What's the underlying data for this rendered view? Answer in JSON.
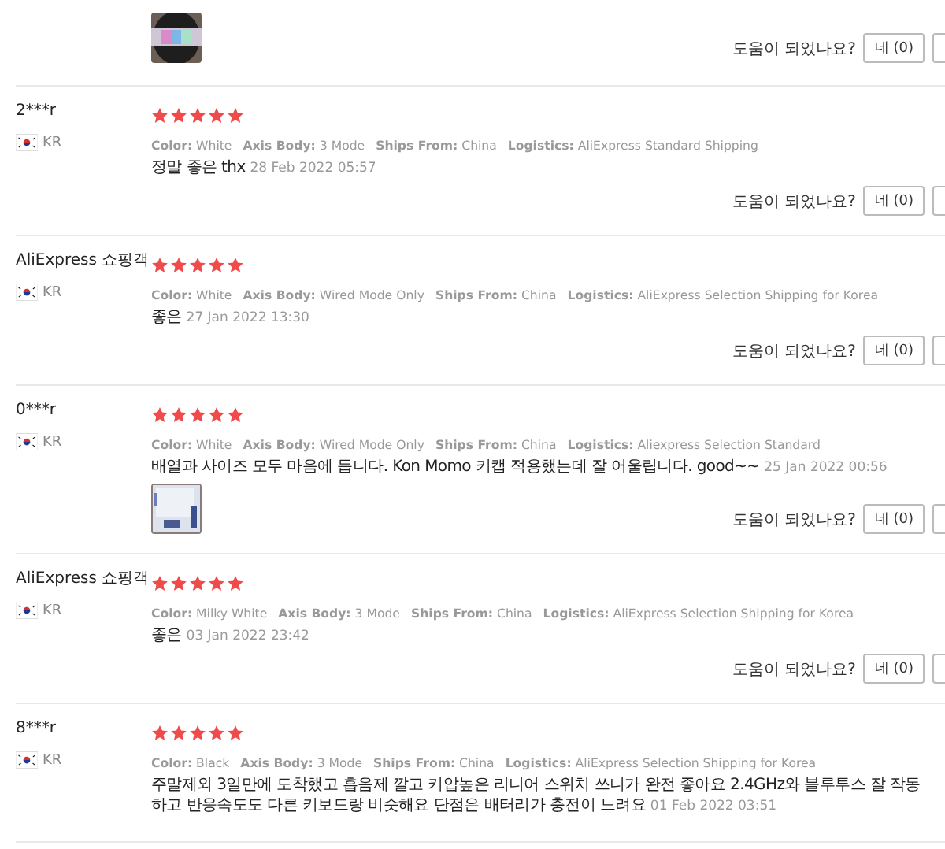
{
  "reviews": [
    {
      "images": [
        {
          "kind": "picture"
        }
      ],
      "helpful": {
        "question": "도움이 되었나요?",
        "yes_button": "네 (0)"
      }
    },
    {
      "user": "2***r",
      "country": "KR",
      "stars": 5,
      "specs": [
        {
          "label": "Color:",
          "value": "White"
        },
        {
          "label": "Axis Body:",
          "value": "3 Mode"
        },
        {
          "label": "Ships From:",
          "value": "China"
        },
        {
          "label": "Logistics:",
          "value": "AliExpress Standard Shipping"
        }
      ],
      "comment": "정말 좋은 thx",
      "date": "28 Feb 2022 05:57",
      "helpful": {
        "question": "도움이 되었나요?",
        "yes_button": "네 (0)"
      }
    },
    {
      "user": "AliExpress 쇼핑객",
      "country": "KR",
      "stars": 5,
      "specs": [
        {
          "label": "Color:",
          "value": "White"
        },
        {
          "label": "Axis Body:",
          "value": "Wired Mode Only"
        },
        {
          "label": "Ships From:",
          "value": "China"
        },
        {
          "label": "Logistics:",
          "value": "AliExpress Selection Shipping for Korea"
        }
      ],
      "comment": "좋은",
      "date": "27 Jan 2022 13:30",
      "helpful": {
        "question": "도움이 되었나요?",
        "yes_button": "네 (0)"
      }
    },
    {
      "user": "0***r",
      "country": "KR",
      "stars": 5,
      "specs": [
        {
          "label": "Color:",
          "value": "White"
        },
        {
          "label": "Axis Body:",
          "value": "Wired Mode Only"
        },
        {
          "label": "Ships From:",
          "value": "China"
        },
        {
          "label": "Logistics:",
          "value": "Aliexpress Selection Standard"
        }
      ],
      "comment": "배열과 사이즈 모두 마음에 듭니다. Kon Momo 키캡 적용했는데 잘 어울립니다. good~~",
      "date": "25 Jan 2022 00:56",
      "images": [
        {
          "kind": "picture"
        }
      ],
      "helpful": {
        "question": "도움이 되었나요?",
        "yes_button": "네 (0)"
      }
    },
    {
      "user": "AliExpress 쇼핑객",
      "country": "KR",
      "stars": 5,
      "specs": [
        {
          "label": "Color:",
          "value": "Milky White"
        },
        {
          "label": "Axis Body:",
          "value": "3 Mode"
        },
        {
          "label": "Ships From:",
          "value": "China"
        },
        {
          "label": "Logistics:",
          "value": "AliExpress Selection Shipping for Korea"
        }
      ],
      "comment": "좋은",
      "date": "03 Jan 2022 23:42",
      "helpful": {
        "question": "도움이 되었나요?",
        "yes_button": "네 (0)"
      }
    },
    {
      "user": "8***r",
      "country": "KR",
      "stars": 5,
      "specs": [
        {
          "label": "Color:",
          "value": "Black"
        },
        {
          "label": "Axis Body:",
          "value": "3 Mode"
        },
        {
          "label": "Ships From:",
          "value": "China"
        },
        {
          "label": "Logistics:",
          "value": "AliExpress Selection Shipping for Korea"
        }
      ],
      "comment": "주말제외 3일만에 도착했고 흡음제 깔고 키압높은 리니어 스위치 쓰니가 완전 좋아요 2.4GHz와 블루투스 잘 작동하고 반응속도도 다른 키보드랑 비슷해요 단점은 배터리가 충전이 느려요",
      "date": "01 Feb 2022 03:51"
    }
  ]
}
